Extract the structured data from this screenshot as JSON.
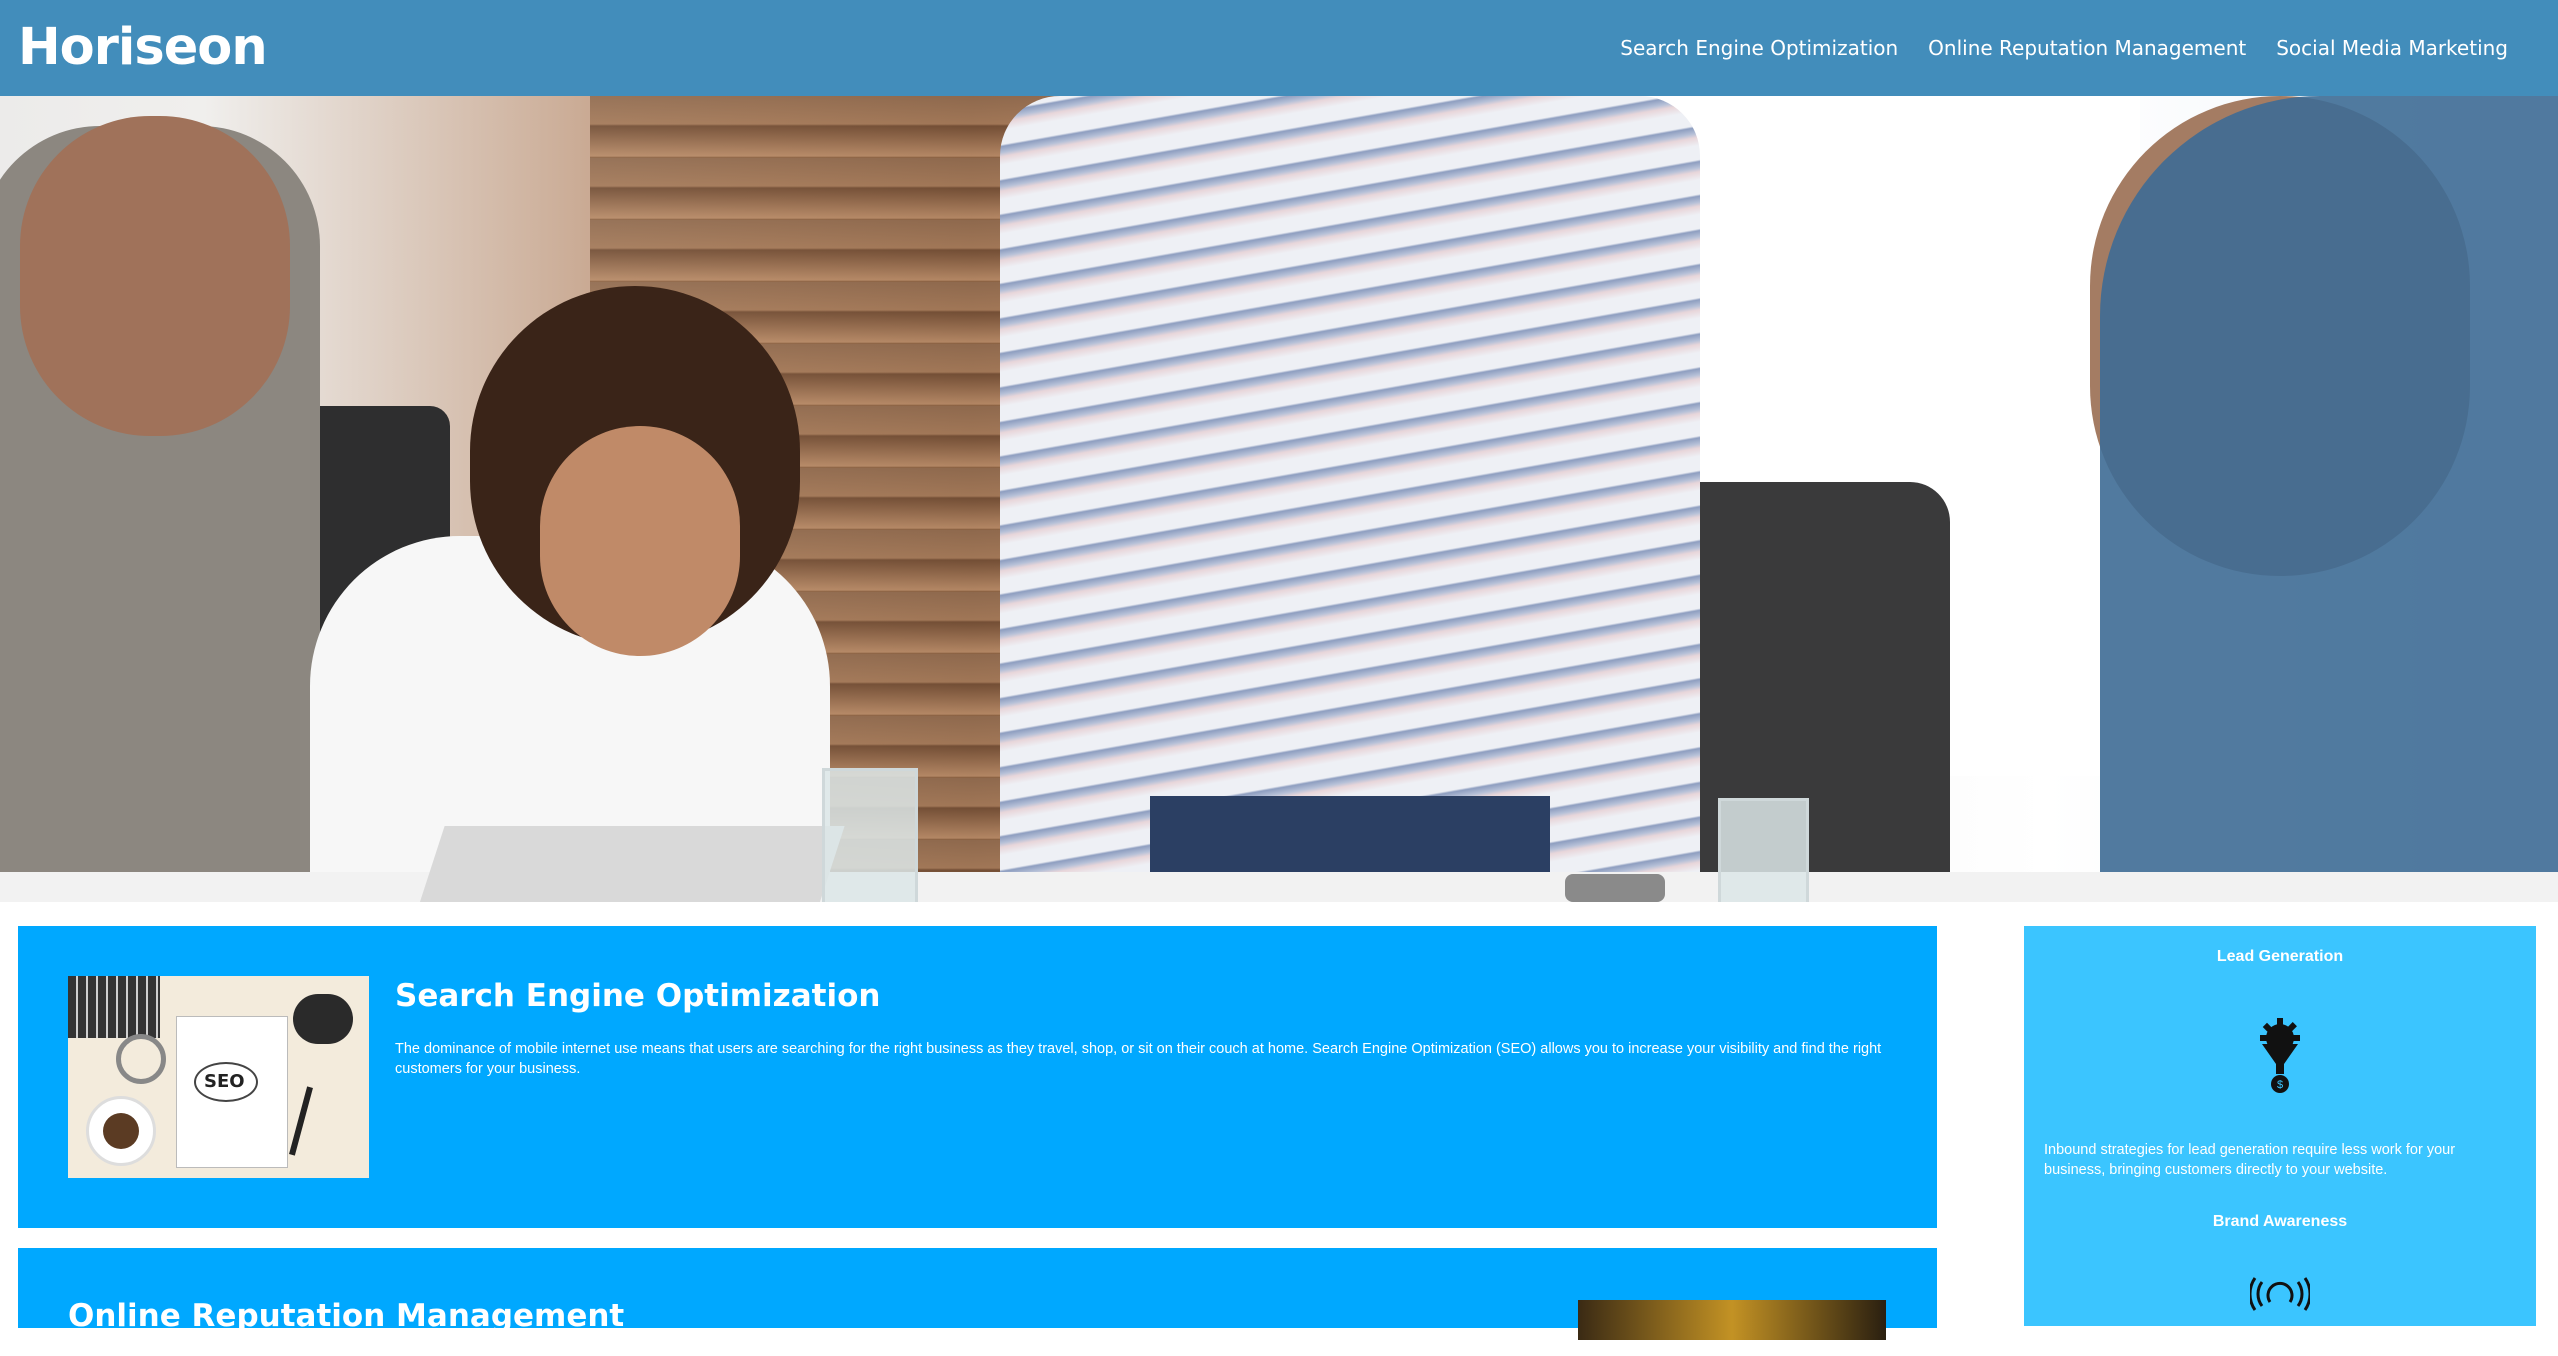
{
  "header": {
    "logo": "Horiseon",
    "nav": [
      {
        "label": "Search Engine Optimization"
      },
      {
        "label": "Online Reputation Management"
      },
      {
        "label": "Social Media Marketing"
      }
    ]
  },
  "content": {
    "seo": {
      "title": "Search Engine Optimization",
      "text": "The dominance of mobile internet use means that users are searching for the right business as they travel, shop, or sit on their couch at home. Search Engine Optimization (SEO) allows you to increase your visibility and find the right customers for your business.",
      "image_text": "SEO"
    },
    "orm": {
      "title": "Online Reputation Management"
    }
  },
  "sidebar": {
    "lead_generation": {
      "title": "Lead Generation",
      "text": "Inbound strategies for lead generation require less work for your business, bringing customers directly to your website.",
      "icon": "lead-funnel-gear-icon"
    },
    "brand_awareness": {
      "title": "Brand Awareness",
      "icon": "lightbulb-broadcast-icon"
    }
  },
  "colors": {
    "header_bg": "#428dbb",
    "card_bg": "#00a8ff",
    "sidebar_bg": "#3bc5ff",
    "text": "#ffffff"
  }
}
